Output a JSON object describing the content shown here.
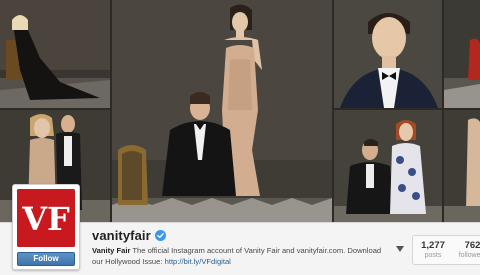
{
  "profile": {
    "username": "vanityfair",
    "bio_name": "Vanity Fair",
    "bio_text": "The official Instagram account of Vanity Fair and vanityfair.com. Download our Hollywood Issue: ",
    "bio_link": "http://bit.ly/VFdigital",
    "follow_label": "Follow",
    "avatar_monogram": "VF"
  },
  "stats": {
    "posts_count": "1,277",
    "posts_label": "posts",
    "followers_count": "762",
    "followers_label": "followers"
  },
  "icons": {
    "verified": "verified-badge-icon",
    "more": "chevron-down-icon"
  },
  "colors": {
    "brand_red": "#c8191f",
    "follow_blue": "#3e74ad",
    "verified_blue": "#3897f0",
    "link_blue": "#2d5f8f"
  }
}
